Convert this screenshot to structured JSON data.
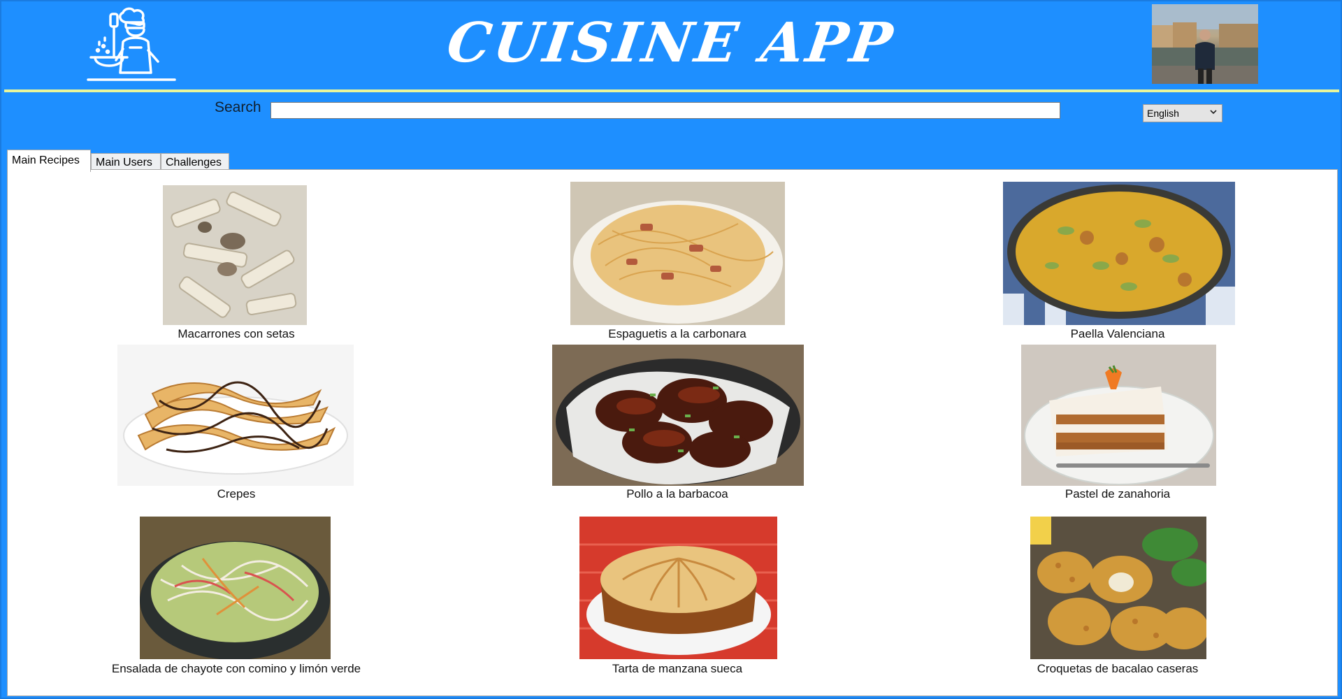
{
  "header": {
    "title": "CUISINE APP",
    "logo_icon": "chef-cooking-icon",
    "avatar_icon": "user-photo"
  },
  "search": {
    "label": "Search",
    "value": "",
    "placeholder": ""
  },
  "language": {
    "selected": "English",
    "icon": "chevron-down-icon"
  },
  "tabs": [
    {
      "label": "Main Recipes",
      "active": true
    },
    {
      "label": "Main Users",
      "active": false
    },
    {
      "label": "Challenges",
      "active": false
    }
  ],
  "recipes": [
    {
      "name": "Macarrones con setas",
      "image": "pasta-mushroom-photo"
    },
    {
      "name": "Espaguetis a la carbonara",
      "image": "spaghetti-carbonara-photo"
    },
    {
      "name": "Paella Valenciana",
      "image": "paella-photo"
    },
    {
      "name": "Crepes",
      "image": "crepes-photo"
    },
    {
      "name": "Pollo a la barbacoa",
      "image": "bbq-chicken-photo"
    },
    {
      "name": "Pastel de zanahoria",
      "image": "carrot-cake-photo"
    },
    {
      "name": "Ensalada de chayote con comino y limón verde",
      "image": "chayote-salad-photo"
    },
    {
      "name": "Tarta de manzana sueca",
      "image": "apple-tart-photo"
    },
    {
      "name": "Croquetas de bacalao caseras",
      "image": "cod-croquettes-photo"
    }
  ],
  "colors": {
    "header_bg": "#1e8fff",
    "accent_rule": "#e8f59b",
    "title_text": "#ffffff"
  }
}
